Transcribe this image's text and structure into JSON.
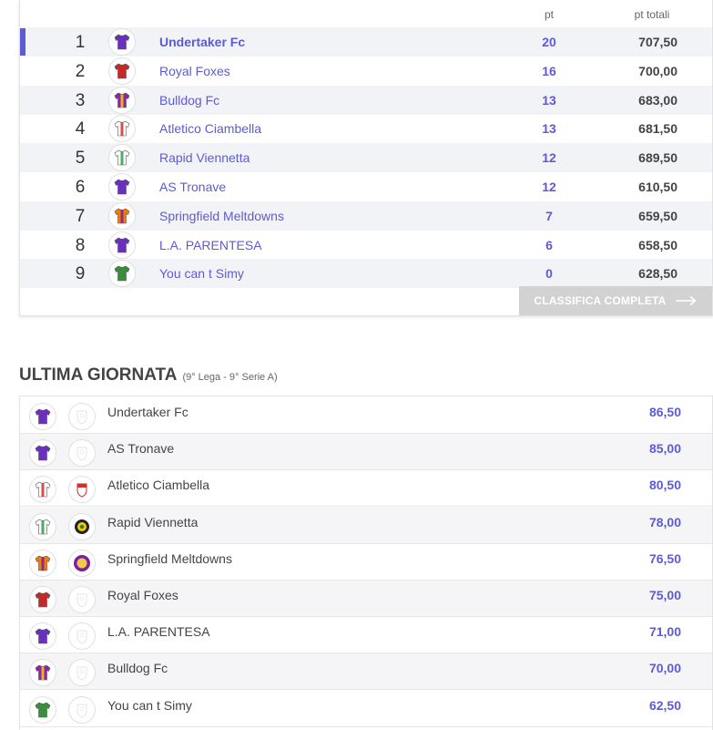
{
  "standings": {
    "header_pt": "pt",
    "header_total": "pt totali",
    "rows": [
      {
        "pos": "1",
        "name": "Undertaker Fc",
        "pt": "20",
        "total": "707,50",
        "jersey": "purple-jersey-icon",
        "color": "#6b2fc0",
        "stripe": "#6b2fc0"
      },
      {
        "pos": "2",
        "name": "Royal Foxes",
        "pt": "16",
        "total": "700,00",
        "jersey": "red-jersey-icon",
        "color": "#c62828",
        "stripe": "#c62828"
      },
      {
        "pos": "3",
        "name": "Bulldog Fc",
        "pt": "13",
        "total": "683,00",
        "jersey": "purple-yellow-jersey-icon",
        "color": "#8e24aa",
        "stripe": "#f5d000"
      },
      {
        "pos": "4",
        "name": "Atletico Ciambella",
        "pt": "13",
        "total": "681,50",
        "jersey": "white-red-jersey-icon",
        "color": "#ffffff",
        "stripe": "#d32f2f"
      },
      {
        "pos": "5",
        "name": "Rapid Viennetta",
        "pt": "12",
        "total": "689,50",
        "jersey": "green-striped-jersey-icon",
        "color": "#ffffff",
        "stripe": "#2e9d48"
      },
      {
        "pos": "6",
        "name": "AS Tronave",
        "pt": "12",
        "total": "610,50",
        "jersey": "purple-jersey-icon",
        "color": "#6b2fc0",
        "stripe": "#6b2fc0"
      },
      {
        "pos": "7",
        "name": "Springfield Meltdowns",
        "pt": "7",
        "total": "659,50",
        "jersey": "orange-purple-jersey-icon",
        "color": "#f57c00",
        "stripe": "#7b1fa2"
      },
      {
        "pos": "8",
        "name": "L.A. PARENTESA",
        "pt": "6",
        "total": "658,50",
        "jersey": "purple-jersey-icon",
        "color": "#6b2fc0",
        "stripe": "#6b2fc0"
      },
      {
        "pos": "9",
        "name": "You can t Simy",
        "pt": "0",
        "total": "628,50",
        "jersey": "green-jersey-icon",
        "color": "#388e3c",
        "stripe": "#388e3c"
      }
    ],
    "button_label": "CLASSIFICA COMPLETA"
  },
  "last_round": {
    "title": "ULTIMA GIORNATA",
    "subtitle": "(9° Lega - 9° Serie A)",
    "rows": [
      {
        "name": "Undertaker Fc",
        "score": "86,50",
        "jersey": "purple-jersey-icon",
        "color": "#6b2fc0",
        "stripe": "#6b2fc0",
        "crest": "empty-crest-icon"
      },
      {
        "name": "AS Tronave",
        "score": "85,00",
        "jersey": "purple-jersey-icon",
        "color": "#6b2fc0",
        "stripe": "#6b2fc0",
        "crest": "empty-crest-icon"
      },
      {
        "name": "Atletico Ciambella",
        "score": "80,50",
        "jersey": "white-red-jersey-icon",
        "color": "#ffffff",
        "stripe": "#d32f2f",
        "crest": "red-white-crest-icon"
      },
      {
        "name": "Rapid Viennetta",
        "score": "78,00",
        "jersey": "green-striped-jersey-icon",
        "color": "#ffffff",
        "stripe": "#2e9d48",
        "crest": "black-yellow-crest-icon"
      },
      {
        "name": "Springfield Meltdowns",
        "score": "76,50",
        "jersey": "orange-purple-jersey-icon",
        "color": "#f57c00",
        "stripe": "#7b1fa2",
        "crest": "purple-crest-icon"
      },
      {
        "name": "Royal Foxes",
        "score": "75,00",
        "jersey": "red-jersey-icon",
        "color": "#c62828",
        "stripe": "#c62828",
        "crest": "empty-crest-icon"
      },
      {
        "name": "L.A. PARENTESA",
        "score": "71,00",
        "jersey": "purple-jersey-icon",
        "color": "#6b2fc0",
        "stripe": "#6b2fc0",
        "crest": "empty-crest-icon"
      },
      {
        "name": "Bulldog Fc",
        "score": "70,00",
        "jersey": "purple-yellow-jersey-icon",
        "color": "#8e24aa",
        "stripe": "#f5d000",
        "crest": "empty-crest-icon"
      },
      {
        "name": "You can t Simy",
        "score": "62,50",
        "jersey": "green-jersey-icon",
        "color": "#388e3c",
        "stripe": "#388e3c",
        "crest": "empty-crest-icon"
      }
    ]
  },
  "colors": {
    "accent": "#5d5bd4",
    "button_bg": "#d2d2d2"
  }
}
